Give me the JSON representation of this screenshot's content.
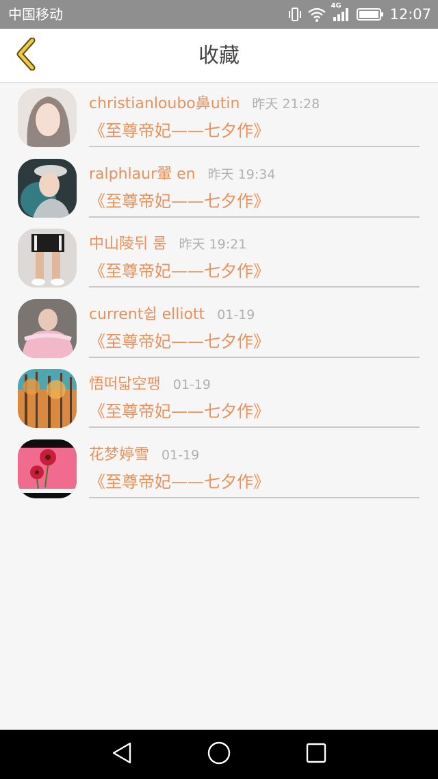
{
  "status_bar": {
    "carrier": "中国移动",
    "network": "4G",
    "time": "12:07"
  },
  "header": {
    "title": "收藏",
    "back_icon": "chevron-left-icon",
    "accent_color": "#e8c14a"
  },
  "favorites": [
    {
      "name": "christianloubo鼻utin",
      "time": "昨天 21:28",
      "subtitle": "《至尊帝妃——七夕作》"
    },
    {
      "name": "ralphlaur翬 en",
      "time": "昨天 19:34",
      "subtitle": "《至尊帝妃——七夕作》"
    },
    {
      "name": "中山陵뒤 룸",
      "time": "昨天 19:21",
      "subtitle": "《至尊帝妃——七夕作》"
    },
    {
      "name": "current쉽 elliott",
      "time": "01-19",
      "subtitle": "《至尊帝妃——七夕作》"
    },
    {
      "name": "悟떠닯空팽",
      "time": "01-19",
      "subtitle": "《至尊帝妃——七夕作》"
    },
    {
      "name": "花梦婷雪",
      "time": "01-19",
      "subtitle": "《至尊帝妃——七夕作》"
    }
  ],
  "colors": {
    "name": "#e8915a",
    "time": "#b0b0b0",
    "divider": "#c8c8c8",
    "background": "#f6f6f6"
  },
  "nav": {
    "back": "nav-back-icon",
    "home": "nav-home-icon",
    "recents": "nav-recents-icon"
  }
}
